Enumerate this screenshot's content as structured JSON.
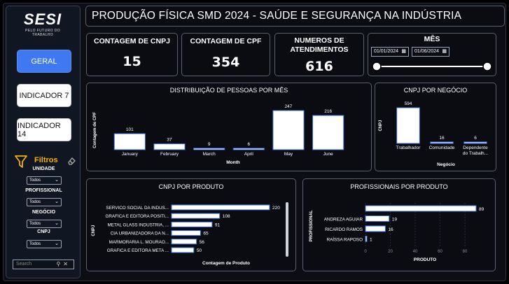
{
  "logo": {
    "text": "SESI",
    "subtitle": "PELO FUTURO DO TRABALHO"
  },
  "nav": {
    "geral": "GERAL",
    "indicador7": "INDICADOR 7",
    "indicador14": "INDICADOR 14"
  },
  "filters": {
    "title": "Filtros",
    "unidade": {
      "label": "UNIDADE",
      "value": "Todos"
    },
    "profissional": {
      "label": "PROFISSIONAL",
      "value": "Todos"
    },
    "negocio": {
      "label": "NEGÓCIO",
      "value": "Todos"
    },
    "cnpj": {
      "label": "CNPJ",
      "value": "Todos"
    },
    "search_placeholder": "Search"
  },
  "header": {
    "title": "PRODUÇÃO FÍSICA SMD 2024 - SAÚDE E SEGURANÇA NA INDÚSTRIA"
  },
  "cards": {
    "cnpj": {
      "label": "CONTAGEM DE CNPJ",
      "value": "15"
    },
    "cpf": {
      "label": "CONTAGEM DE CPF",
      "value": "354"
    },
    "atend": {
      "label_line1": "NUMEROS DE",
      "label_line2": "ATENDIMENTOS",
      "value": "616"
    }
  },
  "mes": {
    "label": "MÊS",
    "start": "01/01/2024",
    "end": "01/06/2024",
    "slider_start_fraction": 0.0,
    "slider_end_fraction": 1.0
  },
  "chart_data": [
    {
      "id": "dist_mes",
      "type": "bar",
      "title": "DISTRIBUIÇÃO DE PESSOAS POR MÊS",
      "xlabel": "Month",
      "ylabel": "Contagem de CPF",
      "categories": [
        "January",
        "February",
        "March",
        "April",
        "May",
        "June"
      ],
      "values": [
        101,
        37,
        9,
        6,
        247,
        216
      ],
      "ylim": [
        0,
        247
      ]
    },
    {
      "id": "cnpj_negocio",
      "type": "bar",
      "title": "CNPJ POR NEGÓCIO",
      "xlabel": "Negócio",
      "ylabel": "CNPJ",
      "categories": [
        "Trabalhador",
        "Comunidade",
        "Dependente do Trabalh..."
      ],
      "values": [
        594,
        16,
        6
      ],
      "ylim": [
        0,
        594
      ]
    },
    {
      "id": "cnpj_produto",
      "type": "bar",
      "orientation": "horizontal",
      "title": "CNPJ POR PRODUTO",
      "xlabel": "Contagem de Produto",
      "ylabel": "CNPJ",
      "categories": [
        "SERVICO SOCIAL DA INDUS...",
        "GRAFICA E EDITORA POSITI...",
        "METAL GLASS INDUSTRIA, ...",
        "CIA URBANIZADORA DA N...",
        "MARMORARIA L. MOURAO...",
        "GRAFICA E EDITORA META ..."
      ],
      "values": [
        220,
        108,
        91,
        65,
        56,
        50
      ],
      "xlim": [
        0,
        220
      ]
    },
    {
      "id": "prof_produto",
      "type": "bar",
      "orientation": "horizontal",
      "title": "PROFISSIONAIS POR PRODUTO",
      "xlabel": "PRODUTO",
      "ylabel": "PROFISSIONAL",
      "categories": [
        "",
        "ANDREZA AGUIAR",
        "RICARDO RAMOS",
        "RAÍSSA RAPOSO"
      ],
      "values": [
        89,
        19,
        16,
        1
      ],
      "xlim": [
        0,
        89
      ],
      "ticks": [
        0,
        20,
        40,
        60,
        80
      ]
    }
  ],
  "colors": {
    "accent": "#3f78f0",
    "filter_accent": "#f5b000",
    "bar_fill": "#ffffff",
    "bar_edge": "#3a6fd8"
  }
}
